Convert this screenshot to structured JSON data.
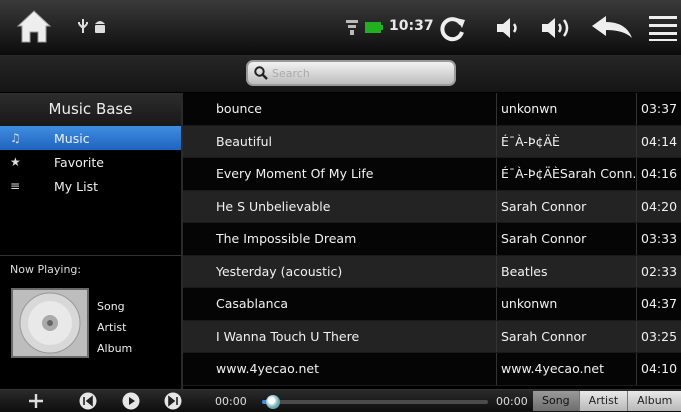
{
  "statusbar": {
    "clock": "10:37",
    "icons": [
      "home-icon",
      "usb-icon",
      "android-icon",
      "signal-icon",
      "battery-icon",
      "refresh-icon",
      "volume-down-icon",
      "volume-up-icon",
      "back-icon",
      "menu-icon"
    ]
  },
  "search": {
    "placeholder": "Search"
  },
  "sidebar": {
    "title": "Music Base",
    "items": [
      {
        "label": "Music",
        "icon": "music-note-icon",
        "active": true
      },
      {
        "label": "Favorite",
        "icon": "star-icon",
        "active": false
      },
      {
        "label": "My List",
        "icon": "playlist-icon",
        "active": false
      }
    ],
    "now_playing_label": "Now Playing:",
    "now_playing": {
      "song": "Song",
      "artist": "Artist",
      "album": "Album"
    }
  },
  "tracks": [
    {
      "title": "bounce",
      "artist": "unkonwn",
      "duration": "03:37"
    },
    {
      "title": "Beautiful",
      "artist": "É¯À-Þ¢ÄÈ",
      "duration": "04:14"
    },
    {
      "title": "Every Moment Of My Life",
      "artist": "É¯À-Þ¢ÄÈSarah Conn...",
      "duration": "04:16"
    },
    {
      "title": "He S Unbelievable",
      "artist": "Sarah Connor",
      "duration": "04:20"
    },
    {
      "title": "The Impossible Dream",
      "artist": "Sarah Connor",
      "duration": "03:33"
    },
    {
      "title": "Yesterday (acoustic)",
      "artist": "Beatles",
      "duration": "02:33"
    },
    {
      "title": "Casablanca",
      "artist": "unkonwn",
      "duration": "04:37"
    },
    {
      "title": "I Wanna Touch U There",
      "artist": "Sarah Connor",
      "duration": "03:25"
    },
    {
      "title": "www.4yecao.net",
      "artist": "www.4yecao.net",
      "duration": "04:10"
    }
  ],
  "player": {
    "elapsed": "00:00",
    "total": "00:00",
    "progress_fraction": 0.05,
    "controls": [
      "add-icon",
      "previous-icon",
      "play-icon",
      "next-icon"
    ]
  },
  "sort_tabs": [
    {
      "label": "Song",
      "active": true
    },
    {
      "label": "Artist",
      "active": false
    },
    {
      "label": "Album",
      "active": false
    }
  ],
  "colors": {
    "accent": "#2a78d6",
    "row_alt": "#232323"
  }
}
